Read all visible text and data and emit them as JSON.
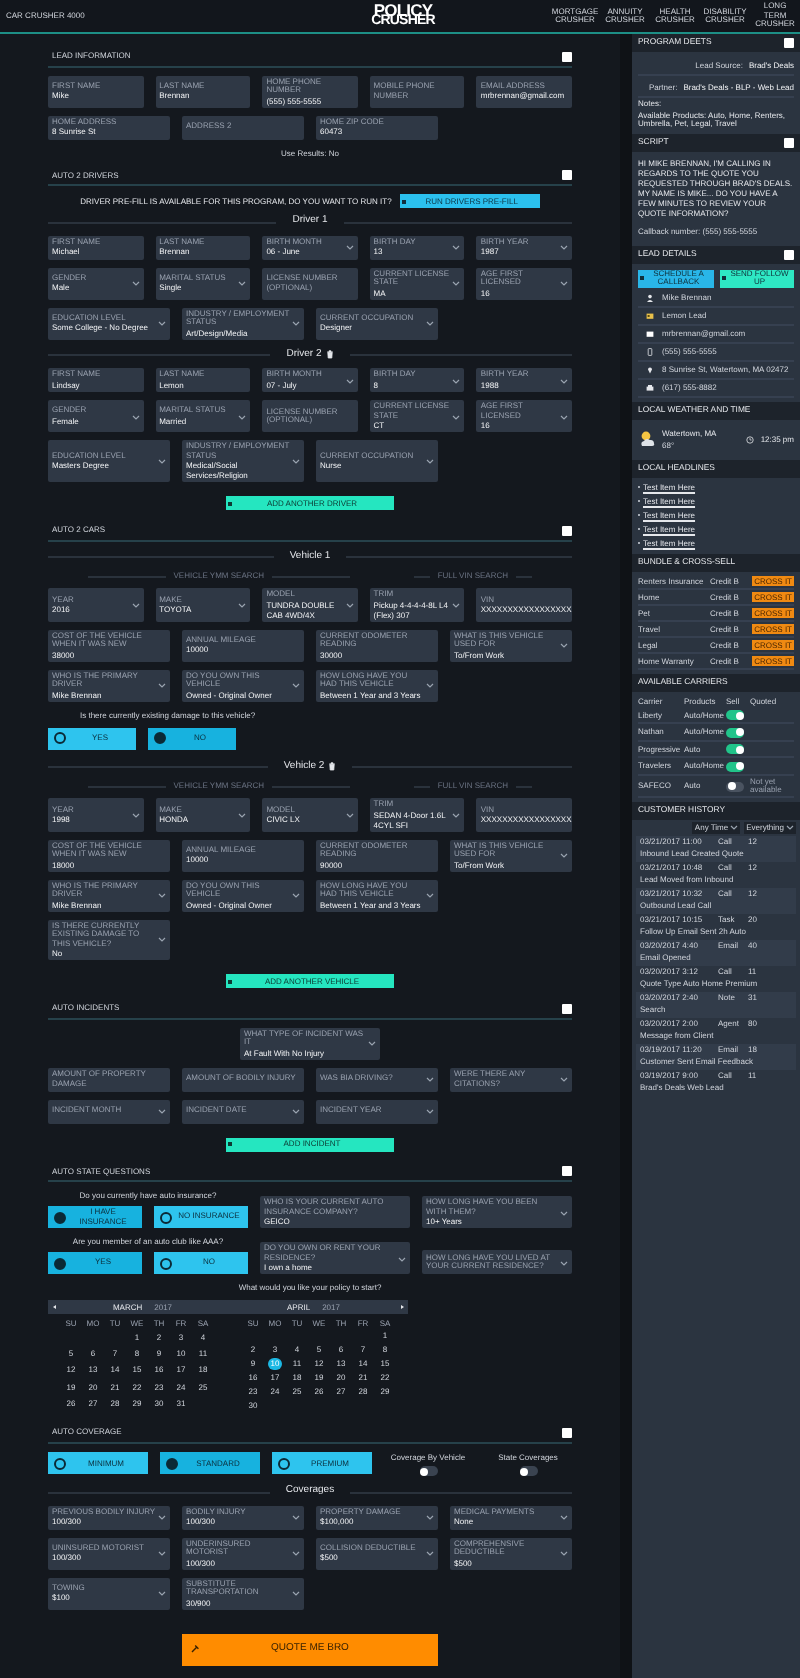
{
  "header": {
    "title": "CAR CRUSHER 4000",
    "logo": [
      "POLICY",
      "CRUSHER"
    ],
    "nav": [
      "MORTGAGE CRUSHER",
      "ANNUITY CRUSHER",
      "HEALTH CRUSHER",
      "DISABILITY CRUSHER",
      "LONG TERM CRUSHER"
    ]
  },
  "sections": [
    {
      "title": "LEAD INFORMATION",
      "checked": false,
      "blocks": [
        {
          "kind": "fields",
          "fields": [
            {
              "kind": "text",
              "label": "FIRST NAME",
              "value": "Mike"
            },
            {
              "kind": "text",
              "label": "LAST NAME",
              "value": "Brennan"
            },
            {
              "kind": "text",
              "label": "HOME PHONE NUMBER",
              "value": "(555) 555-5555"
            },
            {
              "kind": "text",
              "placeholder": "MOBILE PHONE NUMBER"
            },
            {
              "kind": "text",
              "label": "EMAIL ADDRESS",
              "value": "mrbrennan@gmail.com"
            }
          ]
        },
        {
          "kind": "fields",
          "fields": [
            {
              "kind": "text",
              "label": "HOME ADDRESS",
              "value": "8 Sunrise St"
            },
            {
              "kind": "text",
              "placeholder": "ADDRESS 2"
            },
            {
              "kind": "text",
              "label": "HOME ZIP CODE",
              "value": "60473"
            }
          ]
        },
        {
          "kind": "note",
          "text": "Use Results: No"
        }
      ]
    },
    {
      "title": "AUTO 2 DRIVERS",
      "checked": false,
      "blocks": [
        {
          "kind": "prefill",
          "text": "DRIVER PRE-FILL IS AVAILABLE FOR THIS PROGRAM, DO YOU WANT TO RUN IT?",
          "button": "RUN DRIVERS PRE-FILL"
        },
        {
          "kind": "heading",
          "text": "Driver 1",
          "removable": false
        },
        {
          "kind": "fields",
          "fields": [
            {
              "kind": "text",
              "label": "FIRST NAME",
              "value": "Michael"
            },
            {
              "kind": "text",
              "label": "LAST NAME",
              "value": "Brennan"
            },
            {
              "kind": "select",
              "label": "BIRTH MONTH",
              "value": "06 - June"
            },
            {
              "kind": "select",
              "label": "BIRTH DAY",
              "value": "13"
            },
            {
              "kind": "select",
              "label": "BIRTH YEAR",
              "value": "1987"
            }
          ]
        },
        {
          "kind": "fields",
          "fields": [
            {
              "kind": "select",
              "label": "GENDER",
              "value": "Male"
            },
            {
              "kind": "select",
              "label": "MARITAL STATUS",
              "value": "Single"
            },
            {
              "kind": "text",
              "placeholder": "LICENSE NUMBER (OPTIONAL)"
            },
            {
              "kind": "select",
              "label": "CURRENT LICENSE STATE",
              "value": "MA"
            },
            {
              "kind": "select",
              "label": "AGE FIRST LICENSED",
              "value": "16"
            }
          ]
        },
        {
          "kind": "fields",
          "fields": [
            {
              "kind": "select",
              "label": "EDUCATION LEVEL",
              "value": "Some College - No Degree"
            },
            {
              "kind": "select",
              "label": "INDUSTRY / EMPLOYMENT STATUS",
              "value": "Art/Design/Media"
            },
            {
              "kind": "select",
              "label": "CURRENT OCCUPATION",
              "value": "Designer"
            }
          ]
        },
        {
          "kind": "heading",
          "text": "Driver 2",
          "removable": true
        },
        {
          "kind": "fields",
          "fields": [
            {
              "kind": "text",
              "label": "FIRST NAME",
              "value": "Lindsay"
            },
            {
              "kind": "text",
              "label": "LAST NAME",
              "value": "Lemon"
            },
            {
              "kind": "select",
              "label": "BIRTH MONTH",
              "value": "07 - July"
            },
            {
              "kind": "select",
              "label": "BIRTH DAY",
              "value": "8"
            },
            {
              "kind": "select",
              "label": "BIRTH YEAR",
              "value": "1988"
            }
          ]
        },
        {
          "kind": "fields",
          "fields": [
            {
              "kind": "select",
              "label": "GENDER",
              "value": "Female"
            },
            {
              "kind": "select",
              "label": "MARITAL STATUS",
              "value": "Married"
            },
            {
              "kind": "text",
              "placeholder": "LICENSE NUMBER (OPTIONAL)"
            },
            {
              "kind": "select",
              "label": "CURRENT LICENSE STATE",
              "value": "CT"
            },
            {
              "kind": "select",
              "label": "AGE FIRST LICENSED",
              "value": "16"
            }
          ]
        },
        {
          "kind": "fields",
          "fields": [
            {
              "kind": "select",
              "label": "EDUCATION LEVEL",
              "value": "Masters Degree"
            },
            {
              "kind": "select",
              "label": "INDUSTRY / EMPLOYMENT STATUS",
              "value": "Medical/Social Services/Religion"
            },
            {
              "kind": "select",
              "label": "CURRENT OCCUPATION",
              "value": "Nurse"
            }
          ]
        },
        {
          "kind": "add_button",
          "text": "ADD ANOTHER DRIVER"
        }
      ]
    },
    {
      "title": "AUTO 2 CARS",
      "checked": false,
      "blocks": [
        {
          "kind": "heading",
          "text": "Vehicle 1",
          "removable": false
        },
        {
          "kind": "search_labels",
          "labels": [
            "VEHICLE YMM SEARCH",
            "FULL VIN SEARCH"
          ]
        },
        {
          "kind": "fields",
          "fields": [
            {
              "kind": "select",
              "label": "YEAR",
              "value": "2016"
            },
            {
              "kind": "select",
              "label": "MAKE",
              "value": "TOYOTA"
            },
            {
              "kind": "select",
              "label": "MODEL",
              "value": "TUNDRA DOUBLE CAB 4WD/4X"
            },
            {
              "kind": "select",
              "label": "TRIM",
              "value": "Pickup 4-4-4-4-8L L4 (Flex) 307"
            },
            {
              "kind": "text",
              "label": "VIN",
              "value": "XXXXXXXXXXXXXXXXX"
            }
          ]
        },
        {
          "kind": "fields",
          "fields": [
            {
              "kind": "text",
              "label": "COST OF THE VEHICLE WHEN IT WAS NEW",
              "value": "38000"
            },
            {
              "kind": "text",
              "label": "ANNUAL MILEAGE",
              "value": "10000"
            },
            {
              "kind": "text",
              "label": "CURRENT ODOMETER READING",
              "value": "30000"
            },
            {
              "kind": "select",
              "label": "WHAT IS THIS VEHICLE USED FOR",
              "value": "To/From Work"
            }
          ]
        },
        {
          "kind": "fields",
          "fields": [
            {
              "kind": "select",
              "label": "WHO IS THE PRIMARY DRIVER",
              "value": "Mike Brennan"
            },
            {
              "kind": "select",
              "label": "DO YOU OWN THIS VEHICLE",
              "value": "Owned - Original Owner"
            },
            {
              "kind": "select",
              "label": "HOW LONG HAVE YOU HAD THIS VEHICLE",
              "value": "Between 1 Year and 3 Years"
            }
          ]
        },
        {
          "kind": "question",
          "text": "Is there currently existing damage to this vehicle?"
        },
        {
          "kind": "radios",
          "options": [
            {
              "label": "YES",
              "selected": false
            },
            {
              "label": "NO",
              "selected": true
            }
          ]
        },
        {
          "kind": "heading",
          "text": "Vehicle 2",
          "removable": true
        },
        {
          "kind": "search_labels",
          "labels": [
            "VEHICLE YMM SEARCH",
            "FULL VIN SEARCH"
          ]
        },
        {
          "kind": "fields",
          "fields": [
            {
              "kind": "select",
              "label": "YEAR",
              "value": "1998"
            },
            {
              "kind": "select",
              "label": "MAKE",
              "value": "HONDA"
            },
            {
              "kind": "select",
              "label": "MODEL",
              "value": "CIVIC LX"
            },
            {
              "kind": "select",
              "label": "TRIM",
              "value": "SEDAN 4-Door 1.6L 4CYL SFI"
            },
            {
              "kind": "text",
              "label": "VIN",
              "value": "XXXXXXXXXXXXXXXXX"
            }
          ]
        },
        {
          "kind": "fields",
          "fields": [
            {
              "kind": "text",
              "label": "COST OF THE VEHICLE WHEN IT WAS NEW",
              "value": "18000"
            },
            {
              "kind": "text",
              "label": "ANNUAL MILEAGE",
              "value": "10000"
            },
            {
              "kind": "text",
              "label": "CURRENT ODOMETER READING",
              "value": "90000"
            },
            {
              "kind": "select",
              "label": "WHAT IS THIS VEHICLE USED FOR",
              "value": "To/From Work"
            }
          ]
        },
        {
          "kind": "fields",
          "fields": [
            {
              "kind": "select",
              "label": "WHO IS THE PRIMARY DRIVER",
              "value": "Mike Brennan"
            },
            {
              "kind": "select",
              "label": "DO YOU OWN THIS VEHICLE",
              "value": "Owned - Original Owner"
            },
            {
              "kind": "select",
              "label": "HOW LONG HAVE YOU HAD THIS VEHICLE",
              "value": "Between 1 Year and 3 Years"
            }
          ]
        },
        {
          "kind": "fields",
          "fields": [
            {
              "kind": "select",
              "label": "IS THERE CURRENTLY EXISTING DAMAGE TO THIS VEHICLE?",
              "value": "No"
            }
          ]
        },
        {
          "kind": "add_button",
          "text": "ADD ANOTHER VEHICLE"
        }
      ]
    },
    {
      "title": "AUTO INCIDENTS",
      "checked": false,
      "blocks": [
        {
          "kind": "center_field",
          "field": {
            "kind": "select",
            "label": "WHAT TYPE OF INCIDENT WAS IT",
            "value": "At Fault With No Injury"
          }
        },
        {
          "kind": "fields",
          "fields": [
            {
              "kind": "text",
              "placeholder": "AMOUNT OF PROPERTY DAMAGE"
            },
            {
              "kind": "text",
              "placeholder": "AMOUNT OF BODILY INJURY"
            },
            {
              "kind": "select",
              "placeholder": "WAS BIA DRIVING?"
            },
            {
              "kind": "select",
              "placeholder": "WERE THERE ANY CITATIONS?"
            }
          ]
        },
        {
          "kind": "fields",
          "fields": [
            {
              "kind": "select",
              "placeholder": "INCIDENT MONTH"
            },
            {
              "kind": "select",
              "placeholder": "INCIDENT DATE"
            },
            {
              "kind": "select",
              "placeholder": "INCIDENT YEAR"
            }
          ]
        },
        {
          "kind": "add_button",
          "text": "ADD INCIDENT"
        }
      ]
    },
    {
      "title": "AUTO STATE QUESTIONS",
      "checked": false,
      "blocks": [
        {
          "kind": "question_row",
          "question": "Do you currently have auto insurance?",
          "options": [
            {
              "label": "I HAVE INSURANCE",
              "selected": true
            },
            {
              "label": "NO INSURANCE",
              "selected": false
            }
          ],
          "fields": [
            {
              "kind": "text",
              "label": "WHO IS YOUR CURRENT AUTO INSURANCE COMPANY?",
              "value": "GEICO"
            },
            {
              "kind": "select",
              "label": "HOW LONG HAVE YOU BEEN WITH THEM?",
              "value": "10+ Years"
            }
          ]
        },
        {
          "kind": "question_row",
          "question": "Are you member of an auto club like AAA?",
          "options": [
            {
              "label": "YES",
              "selected": true
            },
            {
              "label": "NO",
              "selected": false
            }
          ],
          "fields": [
            {
              "kind": "select",
              "label": "DO YOU OWN OR RENT YOUR RESIDENCE?",
              "value": "I own a home"
            },
            {
              "kind": "select",
              "placeholder": "HOW LONG HAVE YOU LIVED AT YOUR CURRENT RESIDENCE?"
            }
          ]
        },
        {
          "kind": "question",
          "text": "What would you like your policy to start?"
        },
        {
          "kind": "calendar",
          "months": [
            {
              "month": "MARCH",
              "year": "2017",
              "weekdays": [
                "SU",
                "MO",
                "TU",
                "WE",
                "TH",
                "FR",
                "SA"
              ],
              "weeks": [
                [
                  {
                    "day": "1",
                    "selected": false
                  },
                  {
                    "day": "2",
                    "selected": false
                  },
                  {
                    "day": "3",
                    "selected": false
                  },
                  {
                    "day": "4",
                    "selected": false
                  }
                ],
                [
                  {
                    "day": "5",
                    "selected": false
                  },
                  {
                    "day": "6",
                    "selected": false
                  },
                  {
                    "day": "7",
                    "selected": false
                  },
                  {
                    "day": "8",
                    "selected": false
                  },
                  {
                    "day": "9",
                    "selected": false
                  },
                  {
                    "day": "10",
                    "selected": false
                  },
                  {
                    "day": "11",
                    "selected": false
                  }
                ],
                [
                  {
                    "day": "12",
                    "selected": false
                  },
                  {
                    "day": "13",
                    "selected": false
                  },
                  {
                    "day": "14",
                    "selected": false
                  },
                  {
                    "day": "15",
                    "selected": false
                  },
                  {
                    "day": "16",
                    "selected": false
                  },
                  {
                    "day": "17",
                    "selected": false
                  },
                  {
                    "day": "18",
                    "selected": false
                  }
                ],
                [
                  {
                    "day": "19",
                    "selected": false
                  },
                  {
                    "day": "20",
                    "selected": false
                  },
                  {
                    "day": "21",
                    "selected": false
                  },
                  {
                    "day": "22",
                    "selected": false
                  },
                  {
                    "day": "23",
                    "selected": false
                  },
                  {
                    "day": "24",
                    "selected": false
                  },
                  {
                    "day": "25",
                    "selected": false
                  }
                ],
                [
                  {
                    "day": "26",
                    "selected": false
                  },
                  {
                    "day": "27",
                    "selected": false
                  },
                  {
                    "day": "28",
                    "selected": false
                  },
                  {
                    "day": "29",
                    "selected": false
                  },
                  {
                    "day": "30",
                    "selected": false
                  },
                  {
                    "day": "31",
                    "selected": false
                  }
                ]
              ]
            },
            {
              "month": "APRIL",
              "year": "2017",
              "weekdays": [
                "SU",
                "MO",
                "TU",
                "WE",
                "TH",
                "FR",
                "SA"
              ],
              "weeks": [
                [
                  {
                    "day": "1",
                    "selected": false
                  }
                ],
                [
                  {
                    "day": "2",
                    "selected": false
                  },
                  {
                    "day": "3",
                    "selected": false
                  },
                  {
                    "day": "4",
                    "selected": false
                  },
                  {
                    "day": "5",
                    "selected": false
                  },
                  {
                    "day": "6",
                    "selected": false
                  },
                  {
                    "day": "7",
                    "selected": false
                  },
                  {
                    "day": "8",
                    "selected": false
                  }
                ],
                [
                  {
                    "day": "9",
                    "selected": false
                  },
                  {
                    "day": "10",
                    "selected": true
                  },
                  {
                    "day": "11",
                    "selected": false
                  },
                  {
                    "day": "12",
                    "selected": false
                  },
                  {
                    "day": "13",
                    "selected": false
                  },
                  {
                    "day": "14",
                    "selected": false
                  },
                  {
                    "day": "15",
                    "selected": false
                  }
                ],
                [
                  {
                    "day": "16",
                    "selected": false
                  },
                  {
                    "day": "17",
                    "selected": false
                  },
                  {
                    "day": "18",
                    "selected": false
                  },
                  {
                    "day": "19",
                    "selected": false
                  },
                  {
                    "day": "20",
                    "selected": false
                  },
                  {
                    "day": "21",
                    "selected": false
                  },
                  {
                    "day": "22",
                    "selected": false
                  }
                ],
                [
                  {
                    "day": "23",
                    "selected": false
                  },
                  {
                    "day": "24",
                    "selected": false
                  },
                  {
                    "day": "25",
                    "selected": false
                  },
                  {
                    "day": "26",
                    "selected": false
                  },
                  {
                    "day": "27",
                    "selected": false
                  },
                  {
                    "day": "28",
                    "selected": false
                  },
                  {
                    "day": "29",
                    "selected": false
                  }
                ],
                [
                  {
                    "day": "30",
                    "selected": false
                  }
                ]
              ]
            }
          ]
        }
      ]
    },
    {
      "title": "AUTO COVERAGE",
      "checked": false,
      "blocks": [
        {
          "kind": "coverage_choice",
          "options": [
            {
              "label": "MINIMUM",
              "selected": false
            },
            {
              "label": "STANDARD",
              "selected": true
            },
            {
              "label": "PREMIUM",
              "selected": false
            }
          ],
          "toggles": [
            {
              "label": "Coverage By Vehicle",
              "on": false
            },
            {
              "label": "State Coverages",
              "on": false
            }
          ]
        },
        {
          "kind": "heading",
          "text": "Coverages",
          "removable": false
        },
        {
          "kind": "fields",
          "fields": [
            {
              "kind": "select",
              "label": "PREVIOUS BODILY INJURY",
              "value": "100/300"
            },
            {
              "kind": "select",
              "label": "BODILY INJURY",
              "value": "100/300"
            },
            {
              "kind": "select",
              "label": "PROPERTY DAMAGE",
              "value": "$100,000"
            },
            {
              "kind": "select",
              "label": "MEDICAL PAYMENTS",
              "value": "None"
            }
          ]
        },
        {
          "kind": "fields",
          "fields": [
            {
              "kind": "select",
              "label": "UNINSURED MOTORIST",
              "value": "100/300"
            },
            {
              "kind": "select",
              "label": "UNDERINSURED MOTORIST",
              "value": "100/300"
            },
            {
              "kind": "select",
              "label": "COLLISION DEDUCTIBLE",
              "value": "$500"
            },
            {
              "kind": "select",
              "label": "COMPREHENSIVE DEDUCTIBLE",
              "value": "$500"
            }
          ]
        },
        {
          "kind": "fields",
          "fields": [
            {
              "kind": "select",
              "label": "TOWING",
              "value": "$100"
            },
            {
              "kind": "select",
              "label": "SUBSTITUTE TRANSPORTATION",
              "value": "30/900"
            }
          ]
        }
      ]
    }
  ],
  "quote_button": "QUOTE ME BRO",
  "sidebar": [
    {
      "kind": "deets",
      "title": "PROGRAM DEETS",
      "checked": false,
      "rows": [
        {
          "label": "Lead Source:",
          "value": "Brad's Deals"
        },
        {
          "label": "Partner:",
          "value": "Brad's Deals - BLP - Web Lead"
        }
      ],
      "notes": [
        "Notes:",
        "Available Products: Auto, Home, Renters, Umbrella, Pet, Legal, Travel"
      ]
    },
    {
      "kind": "script",
      "title": "SCRIPT",
      "checked": false,
      "text": "HI MIKE BRENNAN, I'M CALLING IN REGARDS TO THE QUOTE YOU REQUESTED THROUGH BRAD'S DEALS. MY NAME IS MIKE... DO YOU HAVE A FEW MINUTES TO REVIEW YOUR QUOTE INFORMATION?",
      "callback": "Callback number: (555) 555-5555"
    },
    {
      "kind": "lead",
      "title": "LEAD DETAILS",
      "checked": false,
      "buttons": [
        {
          "label": "SCHEDULE A CALLBACK",
          "color": "#29b6e8"
        },
        {
          "label": "SEND FOLLOW UP",
          "color": "#2ee8c4"
        }
      ],
      "rows": [
        "Mike Brennan",
        "Lemon Lead",
        "mrbrennan@gmail.com",
        "(555) 555-5555",
        "8 Sunrise St, Watertown, MA 02472",
        "(617) 555-8882"
      ]
    },
    {
      "kind": "weather",
      "title": "LOCAL WEATHER AND TIME",
      "city": "Watertown, MA",
      "temp": "68°",
      "time": "12:35 pm"
    },
    {
      "kind": "headlines",
      "title": "LOCAL HEADLINES",
      "items": [
        "Test Item Here",
        "Test Item Here",
        "Test Item Here",
        "Test Item Here",
        "Test Item Here"
      ]
    },
    {
      "kind": "bundle",
      "title": "BUNDLE & CROSS-SELL",
      "rows": [
        {
          "product": "Renters Insurance",
          "score": "Credit B",
          "action": "CROSS IT"
        },
        {
          "product": "Home",
          "score": "Credit B",
          "action": "CROSS IT"
        },
        {
          "product": "Pet",
          "score": "Credit B",
          "action": "CROSS IT"
        },
        {
          "product": "Travel",
          "score": "Credit B",
          "action": "CROSS IT"
        },
        {
          "product": "Legal",
          "score": "Credit B",
          "action": "CROSS IT"
        },
        {
          "product": "Home Warranty",
          "score": "Credit B",
          "action": "CROSS IT"
        }
      ]
    },
    {
      "kind": "carriers",
      "title": "AVAILABLE CARRIERS",
      "columns": [
        "Carrier",
        "Products",
        "Sell",
        "Quoted"
      ],
      "rows": [
        {
          "carrier": "Liberty",
          "products": "Auto/Home",
          "on": true
        },
        {
          "carrier": "Nathan",
          "products": "Auto/Home",
          "on": true
        },
        {
          "carrier": "Progressive",
          "products": "Auto",
          "on": true
        },
        {
          "carrier": "Travelers",
          "products": "Auto/Home",
          "on": true
        },
        {
          "carrier": "SAFECO",
          "products": "Auto",
          "on": false,
          "note": "Not yet available"
        }
      ]
    },
    {
      "kind": "history",
      "title": "CUSTOMER HISTORY",
      "filters": [
        "Any Time",
        "Everything"
      ],
      "rows": [
        {
          "date": "03/21/2017 11:00",
          "type": "Call",
          "count": "12",
          "text": "Inbound Lead Created Quote"
        },
        {
          "date": "03/21/2017 10:48",
          "type": "Call",
          "count": "12",
          "text": "Lead Moved from Inbound"
        },
        {
          "date": "03/21/2017 10:32",
          "type": "Call",
          "count": "12",
          "text": "Outbound Lead Call"
        },
        {
          "date": "03/21/2017 10:15",
          "type": "Task",
          "count": "20",
          "text": "Follow Up Email Sent 2h Auto"
        },
        {
          "date": "03/20/2017 4:40",
          "type": "Email",
          "count": "40",
          "text": "Email Opened"
        },
        {
          "date": "03/20/2017 3:12",
          "type": "Call",
          "count": "11",
          "text": "Quote Type Auto Home Premium"
        },
        {
          "date": "03/20/2017 2:40",
          "type": "Note",
          "count": "31",
          "text": "Search"
        },
        {
          "date": "03/20/2017 2:00",
          "type": "Agent",
          "count": "80",
          "text": "Message from Client"
        },
        {
          "date": "03/19/2017 11:20",
          "type": "Email",
          "count": "18",
          "text": "Customer Sent Email Feedback"
        },
        {
          "date": "03/19/2017 9:00",
          "type": "Call",
          "count": "11",
          "text": "Brad's Deals Web Lead"
        }
      ]
    }
  ]
}
